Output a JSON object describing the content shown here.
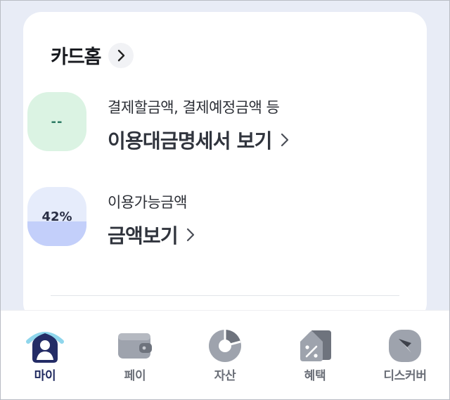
{
  "card": {
    "title": "카드홈",
    "statement": {
      "placeholder": "--",
      "subtitle": "결제할금액, 결제예정금액 등",
      "link": "이용대금명세서 보기"
    },
    "available": {
      "percent_label": "42%",
      "usage_fraction": 0.42,
      "subtitle": "이용가능금액",
      "link": "금액보기"
    }
  },
  "tabs": [
    {
      "label": "마이",
      "icon": "my-home-icon",
      "active": true
    },
    {
      "label": "페이",
      "icon": "wallet-icon",
      "active": false
    },
    {
      "label": "자산",
      "icon": "asset-pie-icon",
      "active": false
    },
    {
      "label": "혜택",
      "icon": "benefit-tag-icon",
      "active": false
    },
    {
      "label": "디스커버",
      "icon": "compass-icon",
      "active": false
    }
  ],
  "colors": {
    "background": "#e8ecf6",
    "accent_navy": "#202a5f",
    "green_tile": "#dbf3e3",
    "blue_tile": "#e6ecfb",
    "blue_fill": "#c3cffa"
  }
}
